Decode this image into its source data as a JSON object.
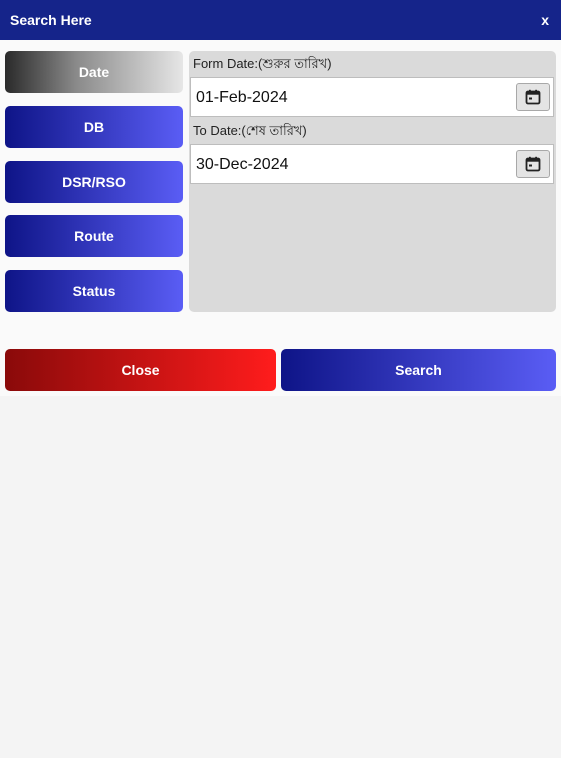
{
  "header": {
    "title": "Search Here",
    "close_label": "x"
  },
  "tabs": [
    {
      "label": "Date",
      "active": true
    },
    {
      "label": "DB",
      "active": false
    },
    {
      "label": "DSR/RSO",
      "active": false
    },
    {
      "label": "Route",
      "active": false
    },
    {
      "label": "Status",
      "active": false
    }
  ],
  "date_filter": {
    "from_label": "Form Date:(শুরুর তারিখ)",
    "from_value": "01-Feb-2024",
    "to_label": "To Date:(শেষ তারিখ)",
    "to_value": "30-Dec-2024",
    "calendar_icon": "calendar-icon"
  },
  "actions": {
    "close_label": "Close",
    "search_label": "Search"
  },
  "colors": {
    "header": "#15248a",
    "tab_gradient_start": "#0e1487",
    "tab_gradient_end": "#5a5df5",
    "close_gradient_start": "#8a0a0a",
    "close_gradient_end": "#ff1c1c"
  }
}
